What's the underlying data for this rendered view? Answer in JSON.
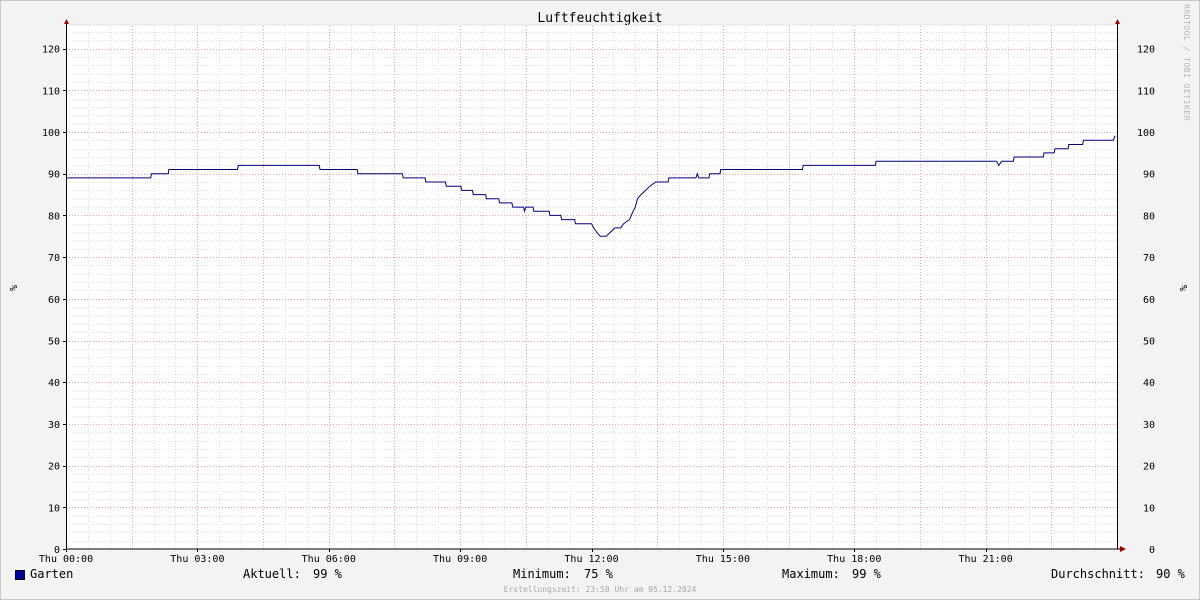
{
  "chart_data": {
    "type": "line",
    "title": "Luftfeuchtigkeit",
    "ylabel": "%",
    "ylabel_right": "%",
    "ylim": [
      0,
      126
    ],
    "yticks": [
      0,
      10,
      20,
      30,
      40,
      50,
      60,
      70,
      80,
      90,
      100,
      110,
      120
    ],
    "xlim": [
      "Thu 00:00",
      "Fri 00:00"
    ],
    "xticks": [
      "Thu 00:00",
      "Thu 03:00",
      "Thu 06:00",
      "Thu 09:00",
      "Thu 12:00",
      "Thu 15:00",
      "Thu 18:00",
      "Thu 21:00"
    ],
    "grid": true,
    "line_color": "#000080",
    "series": [
      {
        "name": "Garten",
        "color": "#0000a0",
        "points": [
          [
            "00:00",
            89
          ],
          [
            "01:56",
            89
          ],
          [
            "01:57",
            90
          ],
          [
            "02:20",
            90
          ],
          [
            "02:21",
            91
          ],
          [
            "03:55",
            91
          ],
          [
            "03:56",
            92
          ],
          [
            "05:47",
            92
          ],
          [
            "05:48",
            91
          ],
          [
            "06:39",
            91
          ],
          [
            "06:40",
            90
          ],
          [
            "07:41",
            90
          ],
          [
            "07:42",
            89
          ],
          [
            "08:12",
            89
          ],
          [
            "08:13",
            88
          ],
          [
            "08:40",
            88
          ],
          [
            "08:41",
            87
          ],
          [
            "09:01",
            87
          ],
          [
            "09:02",
            86
          ],
          [
            "09:17",
            86
          ],
          [
            "09:18",
            85
          ],
          [
            "09:35",
            85
          ],
          [
            "09:36",
            84
          ],
          [
            "09:53",
            84
          ],
          [
            "09:54",
            83
          ],
          [
            "10:11",
            83
          ],
          [
            "10:12",
            82
          ],
          [
            "10:27",
            82
          ],
          [
            "10:28",
            81
          ],
          [
            "10:30",
            82
          ],
          [
            "10:40",
            82
          ],
          [
            "10:41",
            81
          ],
          [
            "11:02",
            81
          ],
          [
            "11:03",
            80
          ],
          [
            "11:18",
            80
          ],
          [
            "11:19",
            79
          ],
          [
            "11:37",
            79
          ],
          [
            "11:38",
            78
          ],
          [
            "12:00",
            78
          ],
          [
            "12:03",
            77
          ],
          [
            "12:07",
            76
          ],
          [
            "12:12",
            75
          ],
          [
            "12:20",
            75
          ],
          [
            "12:26",
            76
          ],
          [
            "12:32",
            77
          ],
          [
            "12:40",
            77
          ],
          [
            "12:44",
            78
          ],
          [
            "12:52",
            79
          ],
          [
            "12:57",
            81
          ],
          [
            "13:00",
            82
          ],
          [
            "13:03",
            84
          ],
          [
            "13:08",
            85
          ],
          [
            "13:14",
            86
          ],
          [
            "13:20",
            87
          ],
          [
            "13:28",
            88
          ],
          [
            "13:45",
            88
          ],
          [
            "13:46",
            89
          ],
          [
            "14:23",
            89
          ],
          [
            "14:25",
            90
          ],
          [
            "14:27",
            89
          ],
          [
            "14:41",
            89
          ],
          [
            "14:42",
            90
          ],
          [
            "14:56",
            90
          ],
          [
            "14:57",
            91
          ],
          [
            "16:49",
            91
          ],
          [
            "16:50",
            92
          ],
          [
            "18:29",
            92
          ],
          [
            "18:30",
            93
          ],
          [
            "21:15",
            93
          ],
          [
            "21:18",
            92
          ],
          [
            "21:22",
            93
          ],
          [
            "21:38",
            93
          ],
          [
            "21:39",
            94
          ],
          [
            "22:19",
            94
          ],
          [
            "22:20",
            95
          ],
          [
            "22:34",
            95
          ],
          [
            "22:35",
            96
          ],
          [
            "22:53",
            96
          ],
          [
            "22:54",
            97
          ],
          [
            "23:13",
            97
          ],
          [
            "23:14",
            98
          ],
          [
            "23:55",
            98
          ],
          [
            "23:57",
            99
          ],
          [
            "23:58",
            99
          ]
        ]
      }
    ]
  },
  "watermark": "RRDTOOL / TOBI OETIKER",
  "legend": {
    "name": "Garten",
    "current_label": "Aktuell:",
    "current_value": "99 %",
    "min_label": "Minimum:",
    "min_value": "75 %",
    "max_label": "Maximum:",
    "max_value": "99 %",
    "avg_label": "Durchschnitt:",
    "avg_value": "90 %"
  },
  "footer": "Erstellungszeit: 23:58 Uhr am 05.12.2024"
}
